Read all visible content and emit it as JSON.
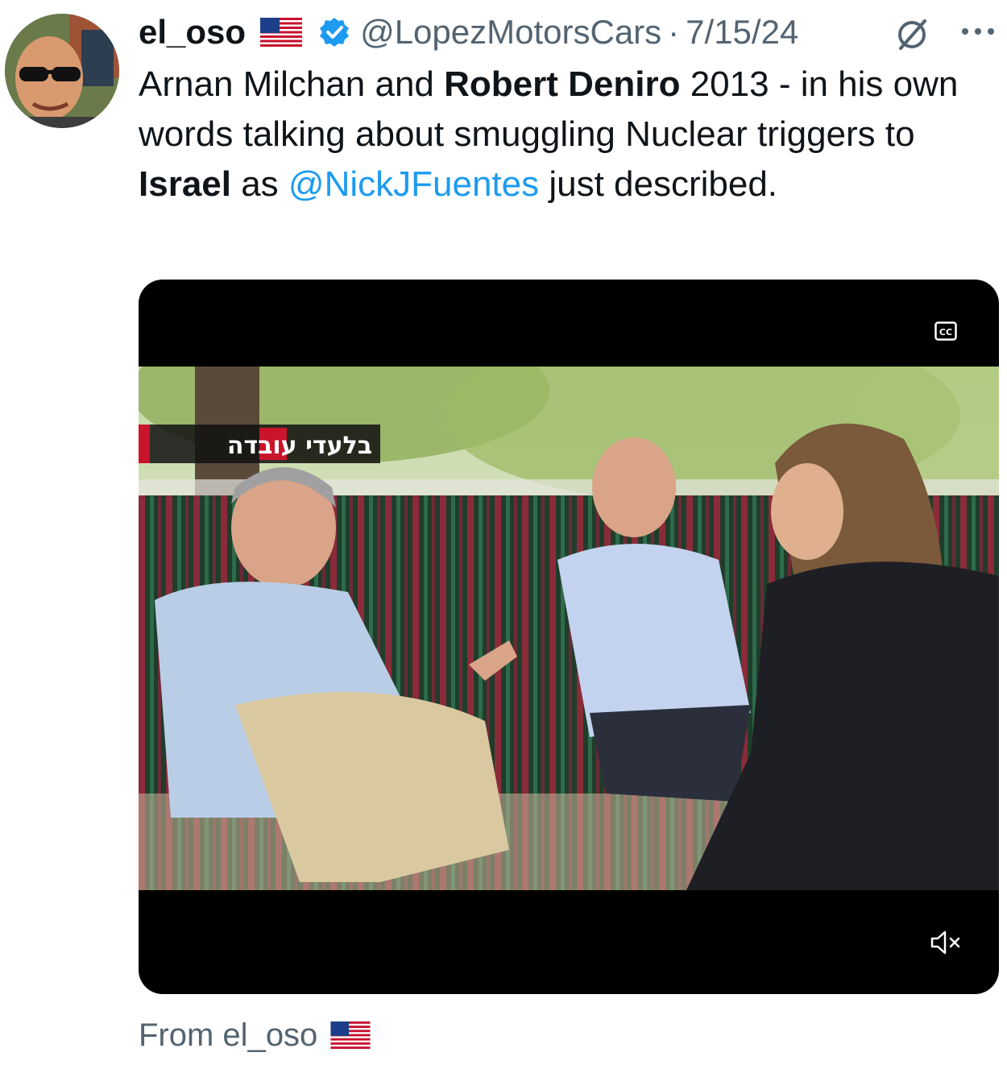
{
  "post": {
    "display_name": "el_oso",
    "name_flag_icon": "us-flag-icon",
    "verified_icon": "verified-badge-icon",
    "handle": "@LopezMotorsCars",
    "separator": "·",
    "date": "7/15/24",
    "grok_icon": "grok-icon",
    "more_icon": "more-options-icon",
    "text": {
      "part1": "Arnan Milchan and ",
      "bold1": "Robert Deniro",
      "part2": " 2013 - in his own words talking about smuggling Nuclear triggers to ",
      "bold2": "Israel",
      "part3": " as ",
      "mention": "@NickJFuentes",
      "part4": " just described."
    },
    "media": {
      "type": "video",
      "overlay_text": "בלעדי עובדה",
      "cc_icon": "closed-captions-icon",
      "mute_icon": "muted-speaker-icon"
    },
    "footer": {
      "from_label": "From el_oso",
      "flag_icon": "us-flag-icon"
    }
  },
  "colors": {
    "text": "#0f1419",
    "secondary": "#536471",
    "accent": "#1d9bf0",
    "media_bg": "#000000"
  }
}
